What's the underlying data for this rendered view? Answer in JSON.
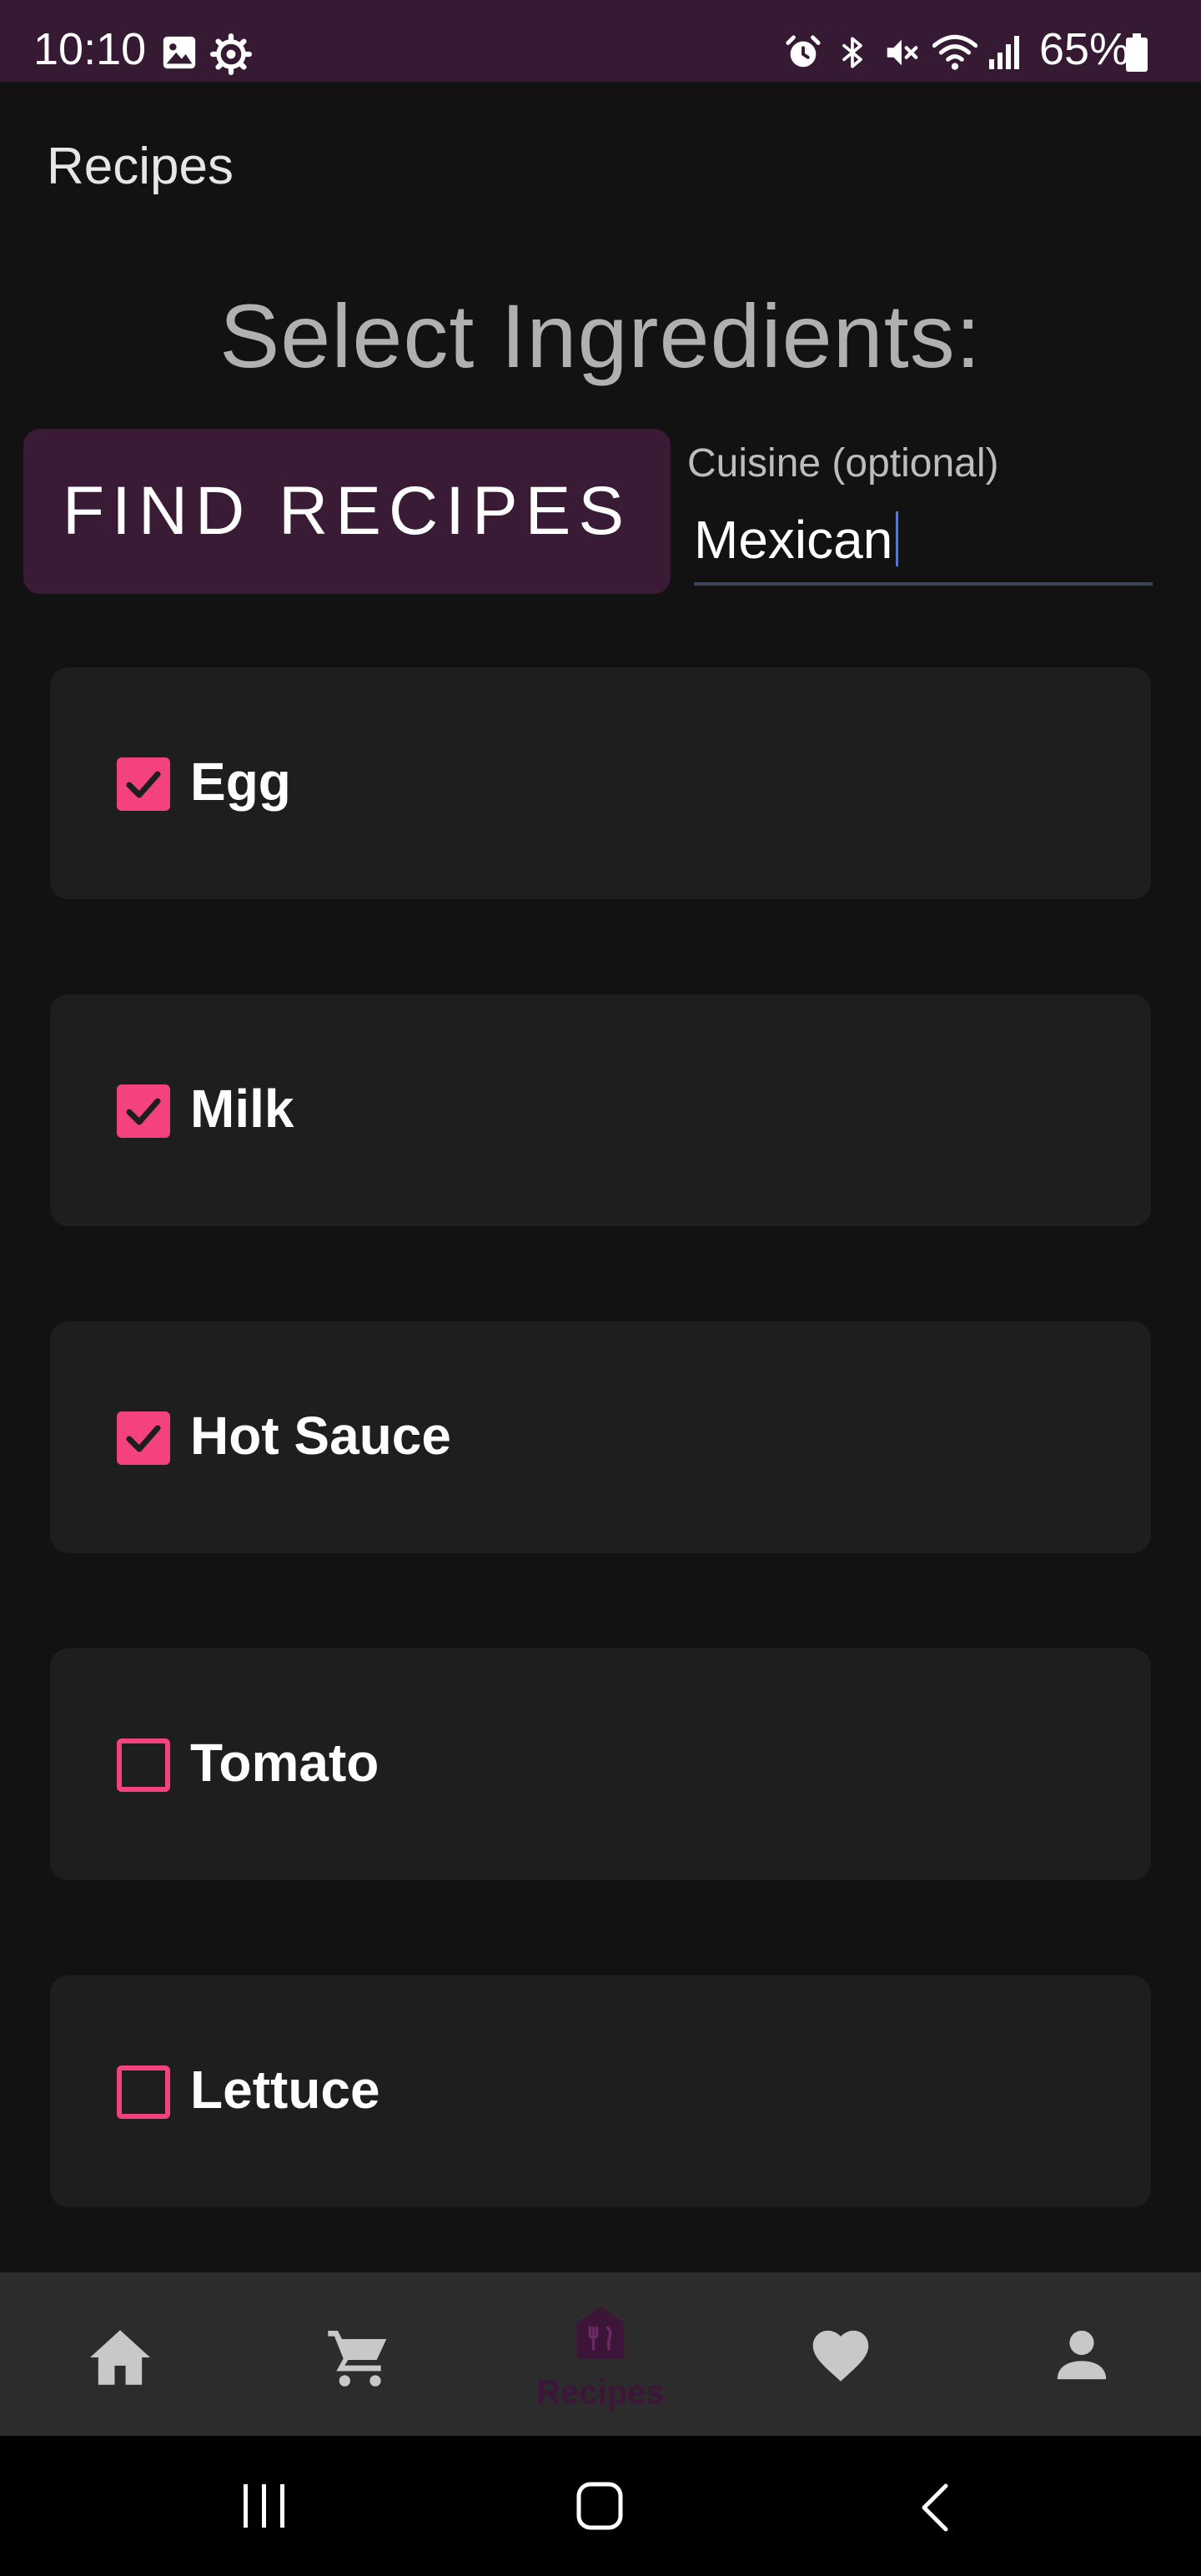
{
  "status_bar": {
    "time": "10:10",
    "battery": "65%",
    "left_icons": [
      "image-icon",
      "settings-icon"
    ],
    "right_icons": [
      "alarm-icon",
      "bluetooth-icon",
      "mute-icon",
      "wifi-icon",
      "signal-icon",
      "battery-icon"
    ]
  },
  "app_bar": {
    "title": "Recipes"
  },
  "main": {
    "heading": "Select Ingredients:",
    "find_button_label": "FIND RECIPES",
    "cuisine": {
      "label": "Cuisine (optional)",
      "value": "Mexican"
    },
    "ingredients": [
      {
        "label": "Egg",
        "checked": true
      },
      {
        "label": "Milk",
        "checked": true
      },
      {
        "label": "Hot Sauce",
        "checked": true
      },
      {
        "label": "Tomato",
        "checked": false
      },
      {
        "label": "Lettuce",
        "checked": false
      }
    ]
  },
  "bottom_nav": {
    "items": [
      {
        "icon": "home-icon",
        "label": ""
      },
      {
        "icon": "cart-icon",
        "label": ""
      },
      {
        "icon": "recipes-icon",
        "label": "Recipes",
        "active": true
      },
      {
        "icon": "heart-icon",
        "label": ""
      },
      {
        "icon": "person-icon",
        "label": ""
      }
    ]
  },
  "colors": {
    "accent": "#f4427f",
    "primary_dark": "#3a1b36",
    "status_bar": "#361a33",
    "background": "#121212",
    "card": "#1e1e1e",
    "nav_bar": "#2c2c2c",
    "active_nav": "#3d1538",
    "inactive_nav_icon": "#c8c8c8"
  }
}
